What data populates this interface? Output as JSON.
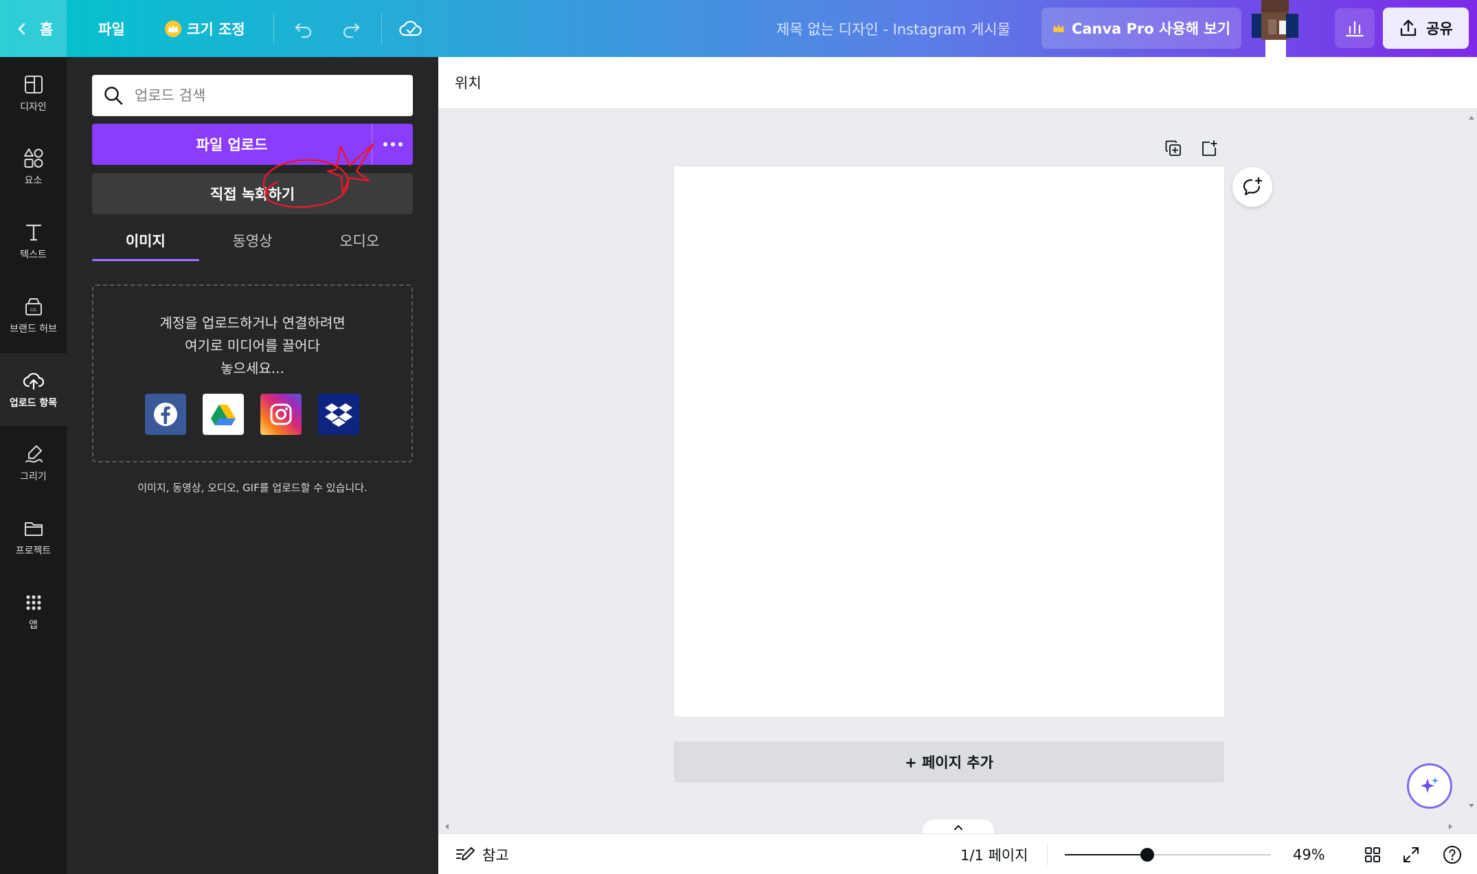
{
  "topbar": {
    "home_label": "홈",
    "file_label": "파일",
    "resize_label": "크기 조정",
    "doc_title": "제목 없는 디자인 - Instagram 게시물",
    "pro_label": "Canva Pro 사용해 보기",
    "share_label": "공유"
  },
  "rail": {
    "items": [
      {
        "label": "디자인",
        "icon": "layout-icon"
      },
      {
        "label": "요소",
        "icon": "shapes-icon"
      },
      {
        "label": "텍스트",
        "icon": "text-icon"
      },
      {
        "label": "브랜드 허브",
        "icon": "brand-hub-icon"
      },
      {
        "label": "업로드 항목",
        "icon": "cloud-upload-icon"
      },
      {
        "label": "그리기",
        "icon": "draw-icon"
      },
      {
        "label": "프로젝트",
        "icon": "folder-icon"
      },
      {
        "label": "앱",
        "icon": "apps-grid-icon"
      }
    ]
  },
  "panel": {
    "search_placeholder": "업로드 검색",
    "upload_label": "파일 업로드",
    "record_label": "직접 녹화하기",
    "tabs": [
      "이미지",
      "동영상",
      "오디오"
    ],
    "active_tab": "이미지",
    "dropzone_lines": [
      "계정을 업로드하거나 연결하려면",
      "여기로 미디어를 끌어다",
      "놓으세요..."
    ],
    "connect_icons": [
      "facebook-icon",
      "google-drive-icon",
      "instagram-icon",
      "dropbox-icon"
    ],
    "hint": "이미지, 동영상, 오디오, GIF를 업로드할 수 있습니다."
  },
  "editor": {
    "position_label": "위치",
    "add_page_label": "+ 페이지 추가"
  },
  "bottombar": {
    "notes_label": "참고",
    "page_indicator": "1/1 페이지",
    "zoom_label": "49%",
    "zoom_fraction": 0.4
  },
  "colors": {
    "accent_purple": "#8b3dff",
    "rail_bg": "#18191b",
    "panel_bg": "#252627",
    "annotation_red": "#e8182b"
  }
}
